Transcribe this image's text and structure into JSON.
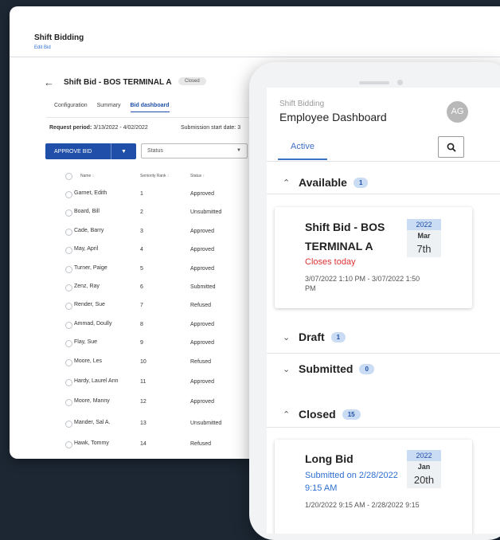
{
  "desktop": {
    "app_title": "Shift Bidding",
    "app_sub": "Edit Bid",
    "bid_title": "Shift Bid - BOS TERMINAL A",
    "status_badge": "Closed",
    "tabs": [
      "Configuration",
      "Summary",
      "Bid dashboard"
    ],
    "request_label": "Request period:",
    "request_value": "3/13/2022 - 4/02/2022",
    "submission_label": "Submission start date: 3",
    "approve_label": "APPROVE BID",
    "status_placeholder": "Status",
    "columns": [
      "Name",
      "Seniority Rank",
      "Status"
    ],
    "rows": [
      {
        "name": "Garnet, Edith",
        "rank": "1",
        "status": "Approved"
      },
      {
        "name": "Board, Bill",
        "rank": "2",
        "status": "Unsubmitted"
      },
      {
        "name": "Cade, Barry",
        "rank": "3",
        "status": "Approved"
      },
      {
        "name": "May, April",
        "rank": "4",
        "status": "Approved"
      },
      {
        "name": "Turner, Paige",
        "rank": "5",
        "status": "Approved"
      },
      {
        "name": "Zenz, Ray",
        "rank": "6",
        "status": "Submitted"
      },
      {
        "name": "Render, Sue",
        "rank": "7",
        "status": "Refused"
      },
      {
        "name": "Ammad, Doully",
        "rank": "8",
        "status": "Approved"
      },
      {
        "name": "Flay, Sue",
        "rank": "9",
        "status": "Approved"
      },
      {
        "name": "Moore, Les",
        "rank": "10",
        "status": "Refused"
      },
      {
        "name": "Hardy, Laurel Ann",
        "rank": "11",
        "status": "Approved"
      },
      {
        "name": "Moore, Manny",
        "rank": "12",
        "status": "Approved"
      },
      {
        "name": "Mander, Sal A.",
        "rank": "13",
        "status": "Unsubmitted"
      },
      {
        "name": "Hawk, Tommy",
        "rank": "14",
        "status": "Refused"
      }
    ]
  },
  "mobile": {
    "subtitle": "Shift Bidding",
    "title": "Employee Dashboard",
    "avatar_initials": "AG",
    "tab_active": "Active",
    "sections": {
      "available": {
        "label": "Available",
        "count": "1"
      },
      "draft": {
        "label": "Draft",
        "count": "1"
      },
      "submitted": {
        "label": "Submitted",
        "count": "0"
      },
      "closed": {
        "label": "Closed",
        "count": "15"
      }
    },
    "card1": {
      "title_line1": "Shift Bid - BOS",
      "title_line2": "TERMINAL A",
      "status": "Closes today",
      "range_line1": "3/07/2022 1:10 PM - 3/07/2022 1:50",
      "range_line2": "PM",
      "year": "2022",
      "month": "Mar",
      "day": "7th"
    },
    "card2": {
      "title": "Long Bid",
      "status_line1": "Submitted on 2/28/2022",
      "status_line2": "9:15 AM",
      "range": "1/20/2022 9:15 AM - 2/28/2022 9:15",
      "year": "2022",
      "month": "Jan",
      "day": "20th"
    }
  }
}
